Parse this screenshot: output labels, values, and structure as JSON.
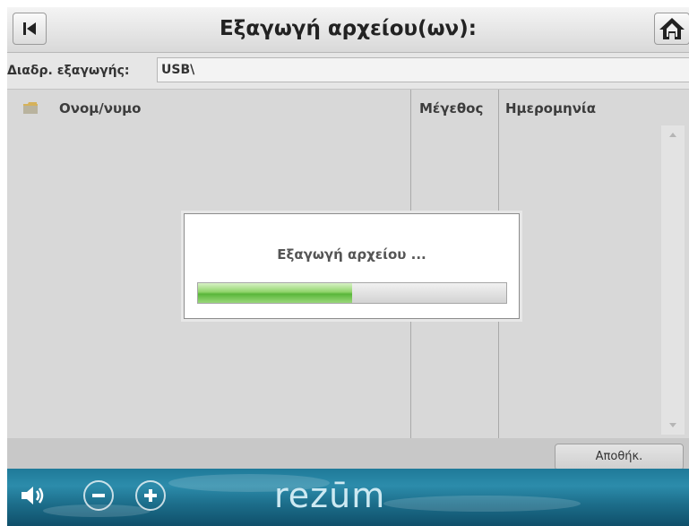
{
  "header": {
    "title": "Εξαγωγή αρχείου(ων):",
    "back_icon": "back-to-start-icon",
    "home_icon": "home-icon"
  },
  "path_row": {
    "label": "Διαδρ. εξαγωγής:",
    "value": "USB\\"
  },
  "file_list": {
    "columns": [
      "Ονομ/νυμο",
      "Μέγεθος",
      "Ημερομηνία"
    ],
    "folder_icon": "folder-icon",
    "rows": []
  },
  "actions": {
    "save_label": "Αποθήκ."
  },
  "footer": {
    "brand": "rezūm",
    "volume_icon": "speaker-icon",
    "minus_icon": "minus-icon",
    "plus_icon": "plus-icon"
  },
  "modal": {
    "message": "Εξαγωγή αρχείου ...",
    "progress": 0.5
  },
  "colors": {
    "progress_green": "#59b63a",
    "footer_blue": "#1f7a99"
  }
}
